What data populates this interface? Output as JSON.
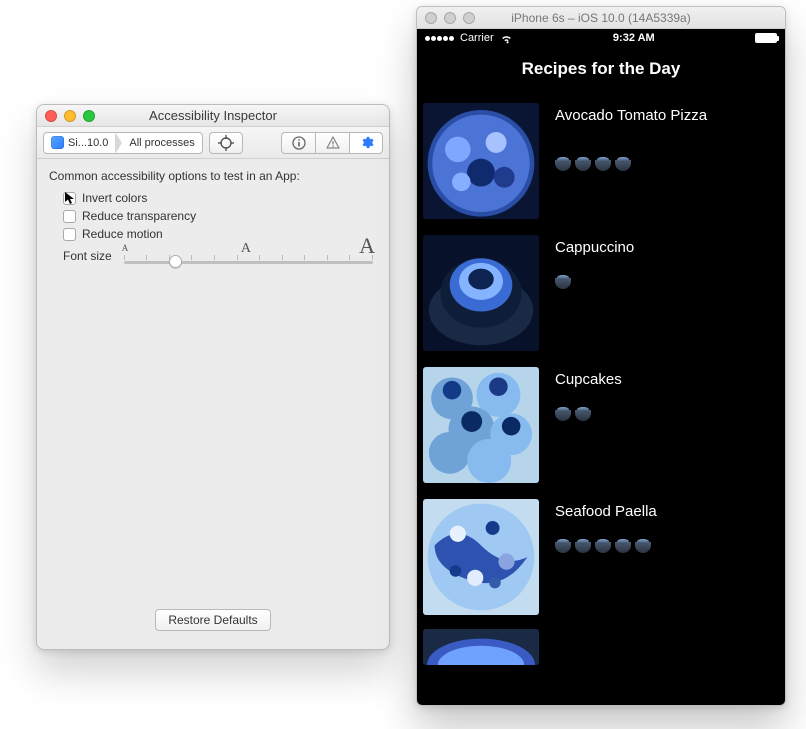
{
  "inspector": {
    "window_title": "Accessibility Inspector",
    "path_sim": "Si...10.0",
    "path_proc": "All processes",
    "prompt": "Common accessibility options to test in an App:",
    "opt_invert": "Invert colors",
    "opt_reduce_transparency": "Reduce transparency",
    "opt_reduce_motion": "Reduce motion",
    "font_size_label": "Font size",
    "restore": "Restore Defaults"
  },
  "simulator": {
    "window_title": "iPhone 6s – iOS 10.0 (14A5339a)",
    "carrier": "Carrier",
    "time": "9:32 AM",
    "screen_title": "Recipes for the Day",
    "recipes": [
      {
        "title": "Avocado Tomato Pizza",
        "rating": 4
      },
      {
        "title": "Cappuccino",
        "rating": 1
      },
      {
        "title": "Cupcakes",
        "rating": 2
      },
      {
        "title": "Seafood Paella",
        "rating": 5
      }
    ]
  }
}
